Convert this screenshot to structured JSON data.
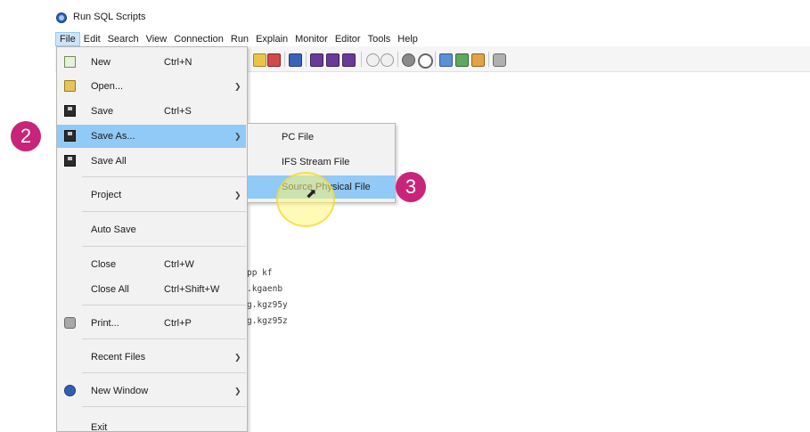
{
  "window": {
    "title": "Run SQL Scripts"
  },
  "menubar": [
    {
      "label": "File",
      "active": true
    },
    {
      "label": "Edit"
    },
    {
      "label": "Search"
    },
    {
      "label": "View"
    },
    {
      "label": "Connection"
    },
    {
      "label": "Run"
    },
    {
      "label": "Explain"
    },
    {
      "label": "Monitor"
    },
    {
      "label": "Editor"
    },
    {
      "label": "Tools"
    },
    {
      "label": "Help"
    }
  ],
  "file_menu": {
    "items": [
      {
        "label": "New",
        "shortcut": "Ctrl+N",
        "icon": "new-icon"
      },
      {
        "label": "Open...",
        "submenu": true,
        "icon": "open-icon"
      },
      {
        "label": "Save",
        "shortcut": "Ctrl+S",
        "icon": "save-icon"
      },
      {
        "label": "Save As...",
        "submenu": true,
        "icon": "save-as-icon",
        "highlighted": true
      },
      {
        "label": "Save All",
        "icon": "save-all-icon"
      },
      {
        "label": "Project",
        "submenu": true
      },
      {
        "label": "Auto Save"
      },
      {
        "label": "Close",
        "shortcut": "Ctrl+W"
      },
      {
        "label": "Close All",
        "shortcut": "Ctrl+Shift+W"
      },
      {
        "label": "Print...",
        "shortcut": "Ctrl+P",
        "icon": "print-icon"
      },
      {
        "label": "Recent Files",
        "submenu": true
      },
      {
        "label": "New Window",
        "submenu": true,
        "icon": "new-window-icon"
      },
      {
        "label": "Exit"
      }
    ]
  },
  "save_as_submenu": {
    "items": [
      {
        "label": "PC File"
      },
      {
        "label": "IFS Stream File"
      },
      {
        "label": "Source Physical File",
        "highlighted": true
      }
    ]
  },
  "editor": {
    "lines": [
      "pp kf",
      ".kgaenb",
      "g.kgz95y",
      "g.kgz95z"
    ]
  },
  "steps": {
    "step_2": "2",
    "step_3": "3"
  },
  "colors": {
    "highlight": "#91c9f7",
    "badge": "#c8247a",
    "menu_bg": "#f2f2f2"
  }
}
